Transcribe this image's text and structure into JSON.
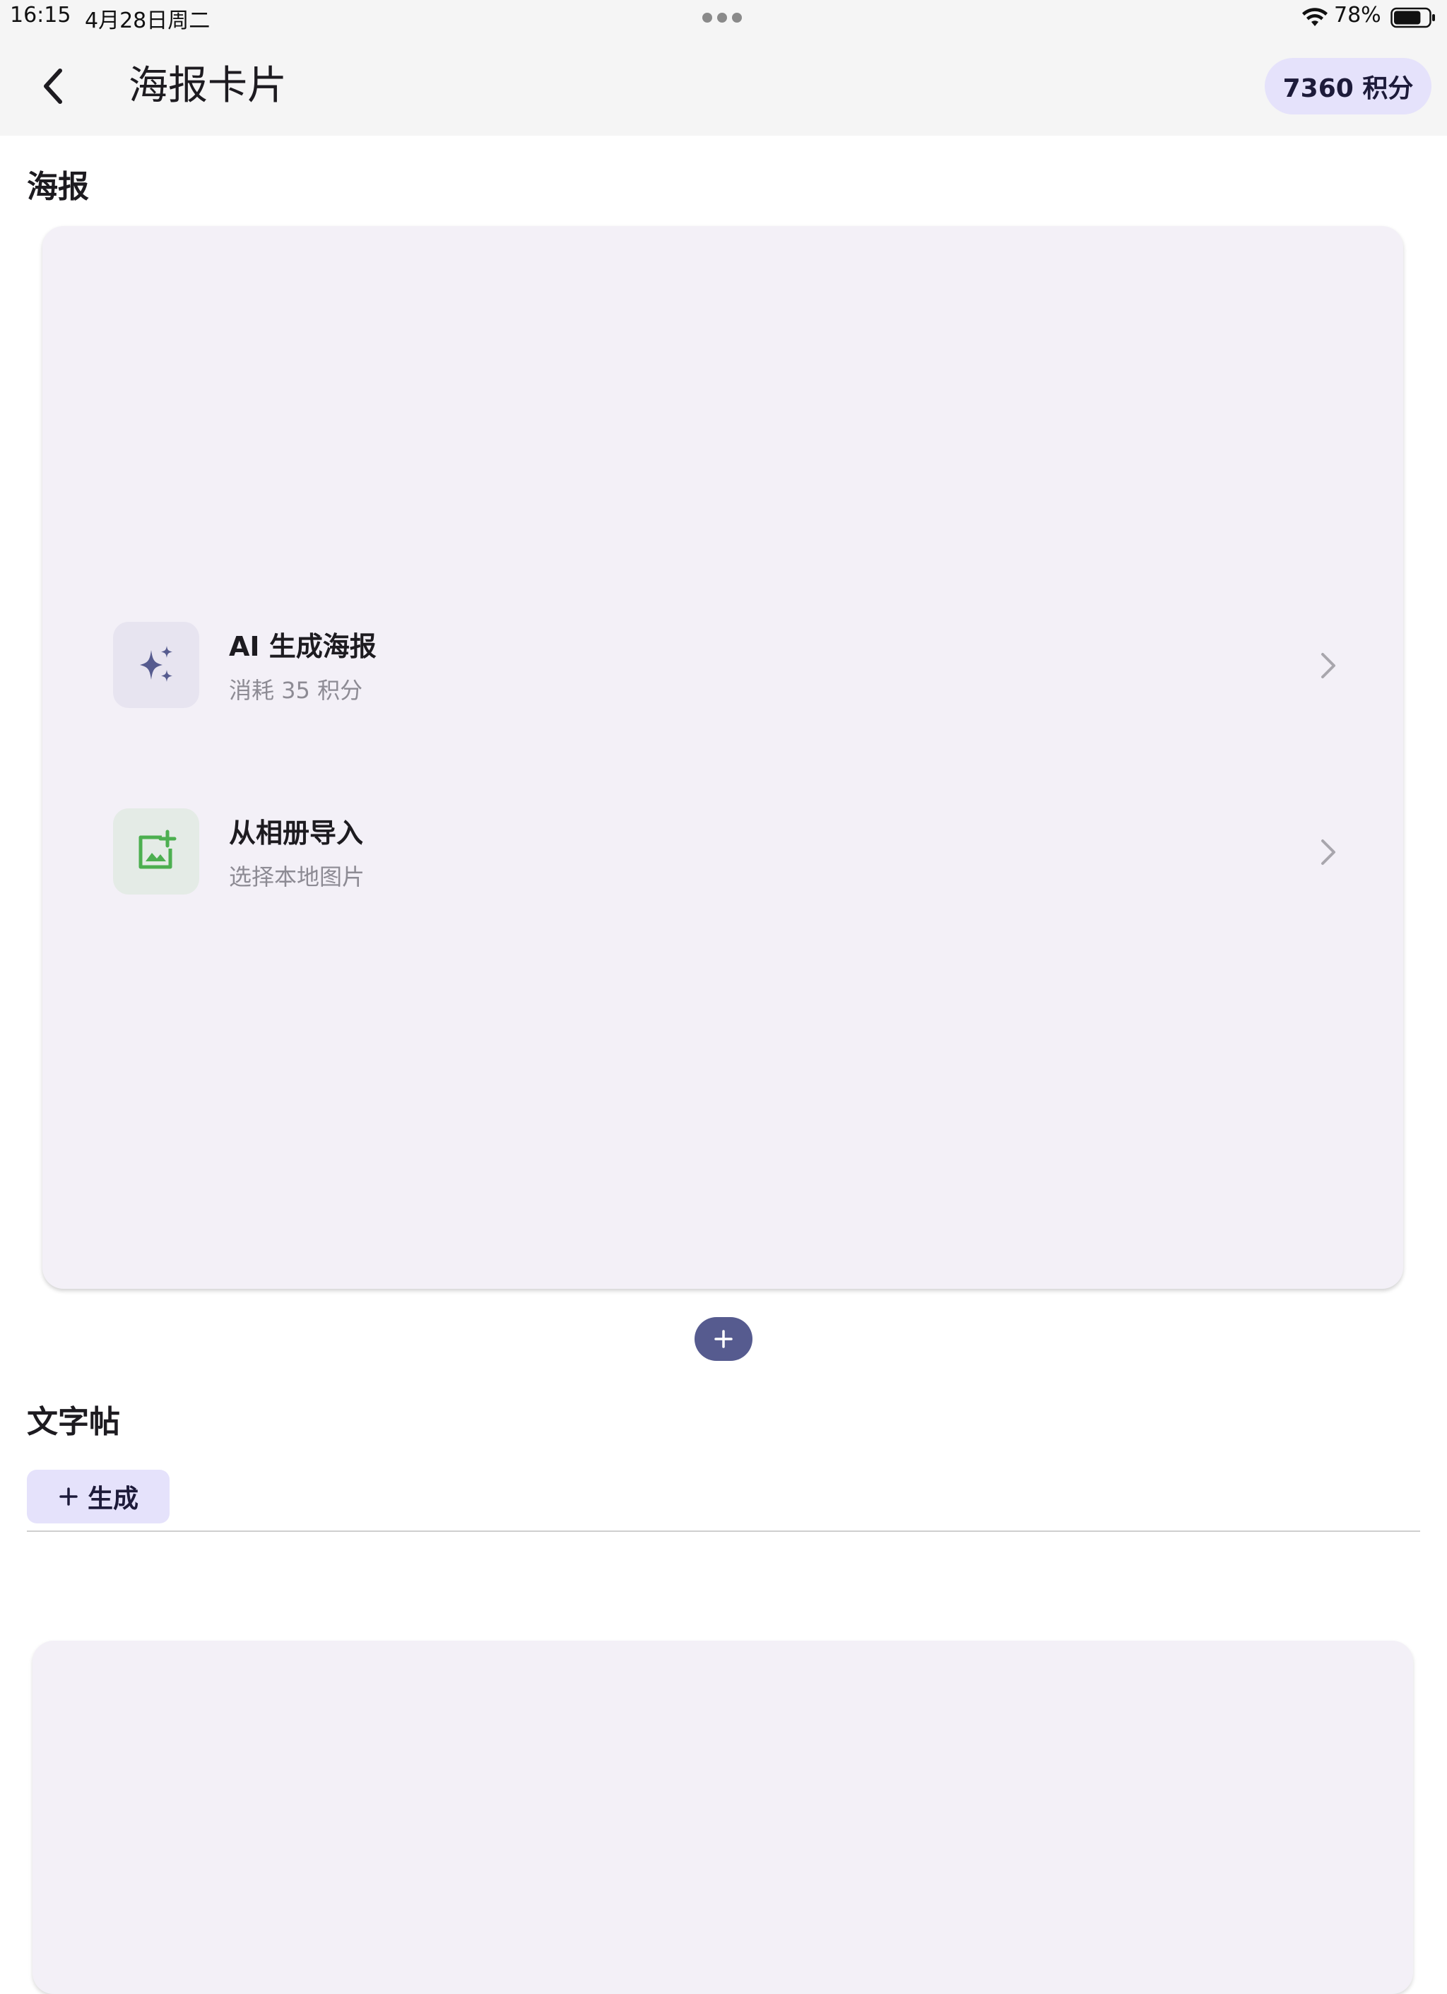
{
  "status_bar": {
    "time": "16:15",
    "date": "4月28日周二",
    "battery_percent": "78%",
    "battery_level": 0.78
  },
  "app_bar": {
    "title": "海报卡片",
    "points_badge": "7360 积分"
  },
  "poster_section": {
    "title": "海报",
    "options": [
      {
        "title": "AI 生成海报",
        "subtitle": "消耗 35 积分",
        "icon": "sparkle-icon"
      },
      {
        "title": "从相册导入",
        "subtitle": "选择本地图片",
        "icon": "add-photo-icon"
      }
    ]
  },
  "text_post_section": {
    "title": "文字帖",
    "generate_label": "生成"
  },
  "colors": {
    "accent": "#565b8f",
    "chip_bg": "#e5e2fb",
    "card_bg": "#f3f0f7",
    "gallery_green": "#4caf50"
  }
}
